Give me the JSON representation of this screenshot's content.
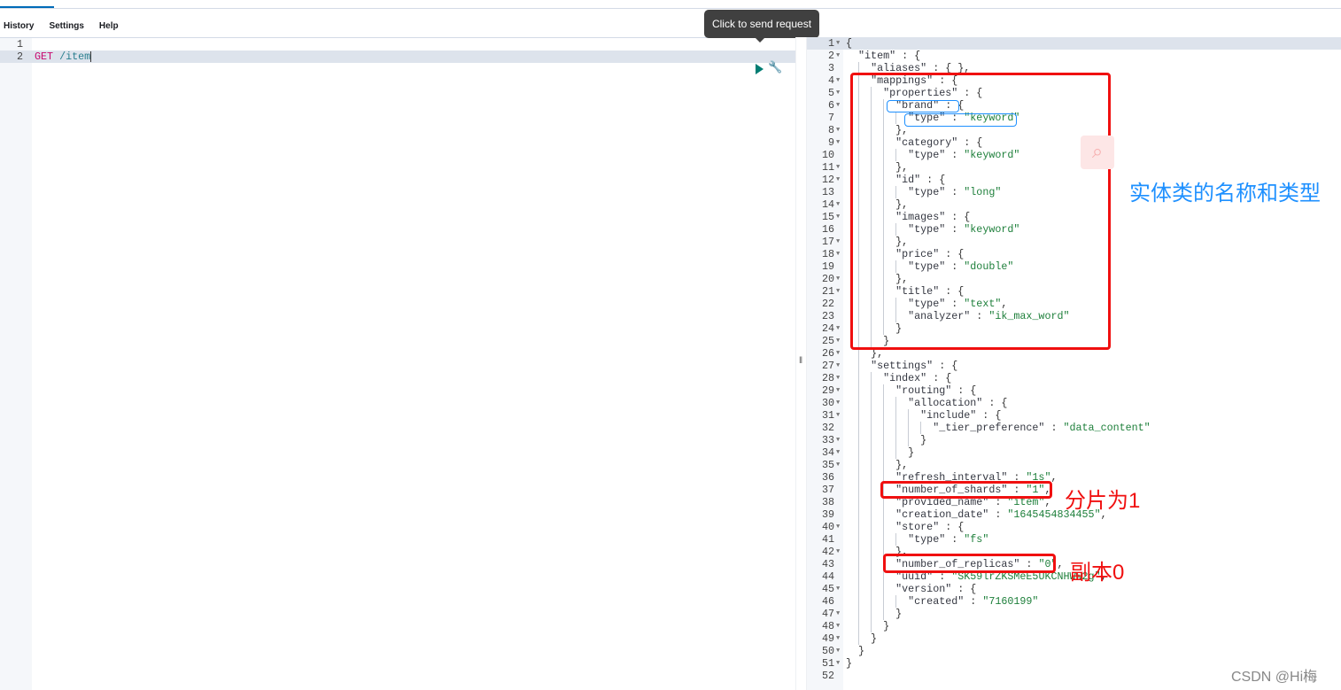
{
  "menu": {
    "history": "History",
    "settings": "Settings",
    "help": "Help"
  },
  "request": {
    "lines": [
      "",
      "GET /item"
    ],
    "method": "GET",
    "path": "/item"
  },
  "tooltip": "Click to send request",
  "icons": {
    "send": "play-icon",
    "settings": "wrench-icon",
    "resize": "drag-handle-icon",
    "search": "search-icon"
  },
  "response_lines": [
    "{",
    "  \"item\" : {",
    "    \"aliases\" : { },",
    "    \"mappings\" : {",
    "      \"properties\" : {",
    "        \"brand\" : {",
    "          \"type\" : \"keyword\"",
    "        },",
    "        \"category\" : {",
    "          \"type\" : \"keyword\"",
    "        },",
    "        \"id\" : {",
    "          \"type\" : \"long\"",
    "        },",
    "        \"images\" : {",
    "          \"type\" : \"keyword\"",
    "        },",
    "        \"price\" : {",
    "          \"type\" : \"double\"",
    "        },",
    "        \"title\" : {",
    "          \"type\" : \"text\",",
    "          \"analyzer\" : \"ik_max_word\"",
    "        }",
    "      }",
    "    },",
    "    \"settings\" : {",
    "      \"index\" : {",
    "        \"routing\" : {",
    "          \"allocation\" : {",
    "            \"include\" : {",
    "              \"_tier_preference\" : \"data_content\"",
    "            }",
    "          }",
    "        },",
    "        \"refresh_interval\" : \"1s\",",
    "        \"number_of_shards\" : \"1\",",
    "        \"provided_name\" : \"item\",",
    "        \"creation_date\" : \"1645454834455\",",
    "        \"store\" : {",
    "          \"type\" : \"fs\"",
    "        },",
    "        \"number_of_replicas\" : \"0\",",
    "        \"uuid\" : \"SK59lrZKSMeE5UKCNHWW2g\",",
    "        \"version\" : {",
    "          \"created\" : \"7160199\"",
    "        }",
    "      }",
    "    }",
    "  }",
    "}",
    ""
  ],
  "annotations": {
    "mappings": "实体类的名称和类型",
    "shards": "分片为1",
    "replicas": "副本0"
  },
  "colors": {
    "annotation_red": "#f01010",
    "annotation_blue": "#1e90ff",
    "accent": "#006bb8"
  },
  "watermark": "CSDN @Hi梅"
}
